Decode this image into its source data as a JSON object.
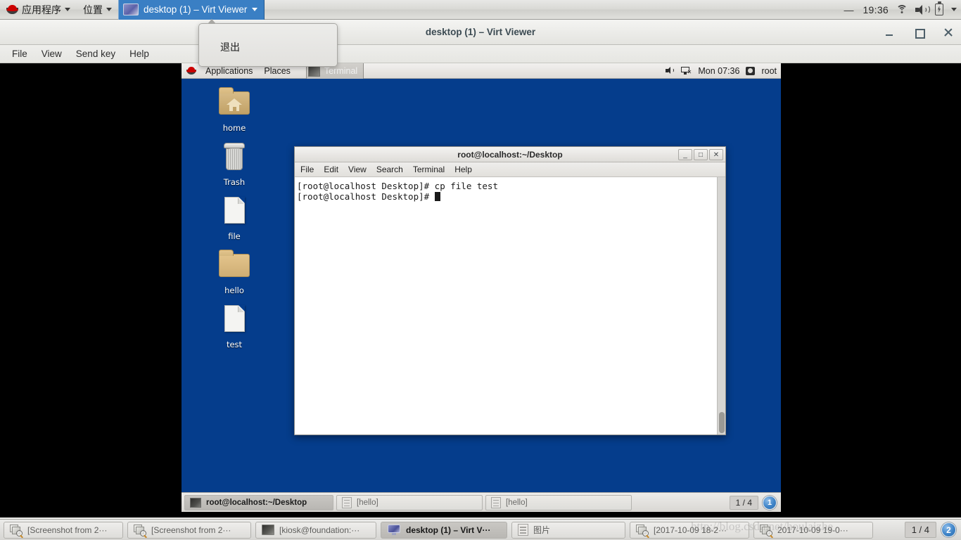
{
  "host_top_panel": {
    "applications_menu": "应用程序",
    "places_menu": "位置",
    "vm_tab_label": "desktop (1) – Virt Viewer",
    "dash": "—",
    "clock": "19:36",
    "icons": [
      "redhat-icon",
      "wifi-icon",
      "volume-icon",
      "battery-icon",
      "chevron-down-icon"
    ]
  },
  "dropdown": {
    "items": [
      "退出"
    ]
  },
  "virt_viewer": {
    "title": "desktop (1) – Virt Viewer",
    "window_buttons": [
      "minimize",
      "maximize",
      "close"
    ],
    "menus": [
      "File",
      "View",
      "Send key",
      "Help"
    ]
  },
  "guest": {
    "top_panel": {
      "applications": "Applications",
      "places": "Places",
      "active_task": "Terminal",
      "clock": "Mon 07:36",
      "user": "root"
    },
    "desktop_icons": [
      {
        "label": "home",
        "type": "folder-home-icon"
      },
      {
        "label": "Trash",
        "type": "trash-icon"
      },
      {
        "label": "file",
        "type": "file-icon"
      },
      {
        "label": "hello",
        "type": "folder-icon"
      },
      {
        "label": "test",
        "type": "file-icon"
      }
    ],
    "terminal": {
      "title": "root@localhost:~/Desktop",
      "menus": [
        "File",
        "Edit",
        "View",
        "Search",
        "Terminal",
        "Help"
      ],
      "lines": [
        "[root@localhost Desktop]# cp file test",
        "[root@localhost Desktop]# "
      ],
      "window_buttons": [
        "_",
        "□",
        "✕"
      ]
    },
    "bottom_panel": {
      "tasks": [
        {
          "label": "root@localhost:~/Desktop",
          "icon": "terminal-icon",
          "active": true
        },
        {
          "label": "[hello]",
          "icon": "file-manager-icon",
          "active": false
        },
        {
          "label": "[hello]",
          "icon": "file-manager-icon",
          "active": false
        }
      ],
      "pager": "1 / 4",
      "workspace_badge": "1"
    }
  },
  "host_taskbar": {
    "tasks": [
      {
        "label": "[Screenshot from 2···",
        "icon": "screenshot-icon",
        "active": false
      },
      {
        "label": "[Screenshot from 2···",
        "icon": "screenshot-icon",
        "active": false
      },
      {
        "label": "[kiosk@foundation:···",
        "icon": "terminal-icon",
        "active": false
      },
      {
        "label": "desktop (1) – Virt V···",
        "icon": "monitor-icon",
        "active": true
      },
      {
        "label": "图片",
        "icon": "file-manager-icon",
        "active": false
      },
      {
        "label": "[2017-10-09 18-2···",
        "icon": "screenshot-icon",
        "active": false
      },
      {
        "label": "2017-10-09 19-0···",
        "icon": "screenshot-icon",
        "active": false
      }
    ],
    "pager": "1 / 4",
    "workspace_badge": "2",
    "watermark": "http://blog.csdn.net/houlaizhe"
  },
  "colors": {
    "desktop_blue": "#053d8c",
    "tab_active_blue": "#3a7fc4",
    "panel_grey": "#dedcd8",
    "terminal_bg": "#ffffff"
  }
}
